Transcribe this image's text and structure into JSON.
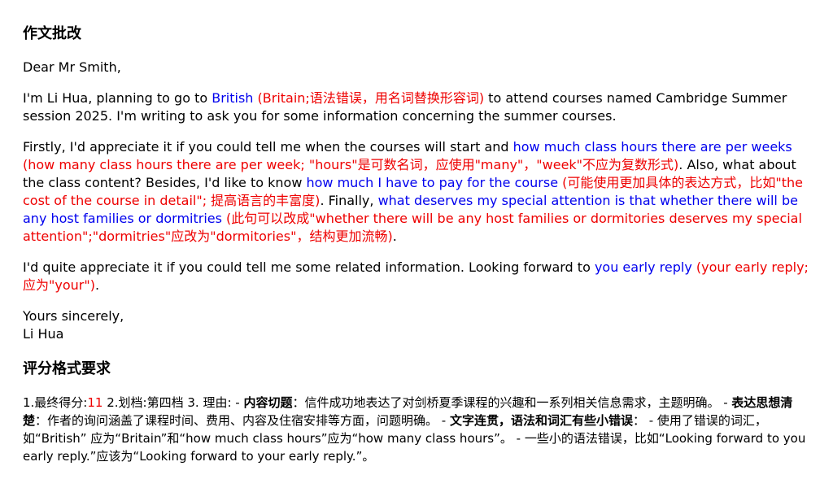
{
  "title": "作文批改",
  "salutation": "Dear Mr Smith,",
  "p1": {
    "a": "I'm Li Hua, planning to go to ",
    "err1": "British",
    "note1": " (Britain;语法错误，用名词替换形容词)",
    "b": " to attend courses named Cambridge Summer session 2025. I'm writing to ask you for some information concerning the summer courses."
  },
  "p2": {
    "a": "Firstly, I'd appreciate it if you could tell me when the courses will start and ",
    "err1": " how much class hours there are per weeks",
    "note1": " (how many class hours there are per week; \"hours\"是可数名词，应使用\"many\"，\"week\"不应为复数形式)",
    "b": ". Also, what about the class content? Besides, I'd like to know ",
    "err2": "how much I have to pay for the course",
    "note2": " (可能使用更加具体的表达方式，比如\"the cost of the course in detail\"; 提高语言的丰富度)",
    "c": ". Finally, ",
    "err3": "what deserves my special attention is that whether there will be any host families or dormitries",
    "note3": " (此句可以改成\"whether there will be any host families or dormitories deserves my special attention\";\"dormitries\"应改为\"dormitories\"，结构更加流畅)",
    "d": "."
  },
  "p3": {
    "a": "I'd quite appreciate it if you could tell me some related information. Looking forward to ",
    "err1": " you early reply",
    "note1": " (your early reply;应为\"your\")",
    "b": "."
  },
  "closing": {
    "line1": "Yours sincerely,",
    "line2": "Li Hua"
  },
  "grading_title": "评分格式要求",
  "grading": {
    "a": "1.最终得分:",
    "score": "11",
    "b": " 2.划档:第四档 3. 理由: - ",
    "c1_label": "内容切题",
    "c1_text": "：信件成功地表达了对剑桥夏季课程的兴趣和一系列相关信息需求，主题明确。 - ",
    "c2_label": "表达思想清楚",
    "c2_text": "：作者的询问涵盖了课程时间、费用、内容及住宿安排等方面，问题明确。 - ",
    "c3_label": "文字连贯，语法和词汇有些小错误",
    "c3_text": "： - 使用了错误的词汇，如“British” 应为“Britain”和“how much class hours”应为“how many class hours”。 - 一些小的语法错误，比如“Looking forward to you early reply.”应该为“Looking forward to your early reply.”。"
  },
  "colors": {
    "error_text": "#0000ee",
    "correction_note": "#ee0000",
    "score": "#ee0000"
  }
}
